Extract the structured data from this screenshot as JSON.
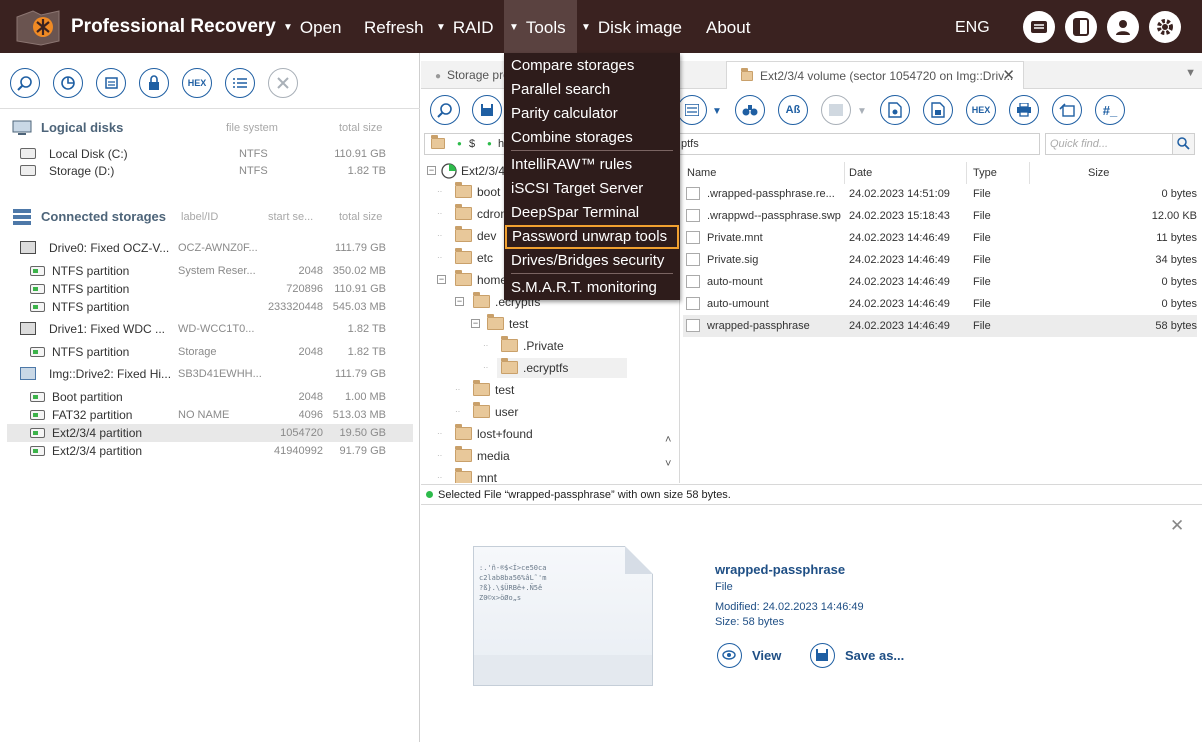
{
  "app": {
    "title": "Professional Recovery",
    "colors": {
      "topbar": "#3a2220",
      "accent": "#1f5fa3",
      "menu_active": "#5a4240",
      "highlight_border": "#f0a030",
      "status_ok": "#2dbb4b"
    }
  },
  "menu": {
    "items": [
      {
        "label": "Open",
        "has_arrow": true
      },
      {
        "label": "Refresh",
        "has_arrow": false
      },
      {
        "label": "RAID",
        "has_arrow": true
      },
      {
        "label": "Tools",
        "has_arrow": true,
        "active": true
      },
      {
        "label": "Disk image",
        "has_arrow": true
      },
      {
        "label": "About",
        "has_arrow": false
      }
    ],
    "language": "ENG",
    "right_icons": [
      "log-icon",
      "panel-toggle-icon",
      "user-icon",
      "settings-gear-icon"
    ]
  },
  "tools_menu": {
    "items": [
      {
        "label": "Compare storages"
      },
      {
        "label": "Parallel search"
      },
      {
        "label": "Parity calculator"
      },
      {
        "label": "Combine storages"
      },
      {
        "label": "IntelliRAW™ rules"
      },
      {
        "label": "iSCSI Target Server"
      },
      {
        "label": "DeepSpar Terminal"
      },
      {
        "label": "Password unwrap tools",
        "highlighted": true
      },
      {
        "label": "Drives/Bridges security"
      },
      {
        "label": "S.M.A.R.T. monitoring"
      }
    ]
  },
  "left": {
    "toolbar_icons": [
      "zoom-icon",
      "pie-chart-icon",
      "scan-icon",
      "lock-icon",
      "hex-icon",
      "list-icon",
      "close-icon"
    ],
    "hex_label": "HEX",
    "logical": {
      "title": "Logical disks",
      "col_fs": "file system",
      "col_size": "total size",
      "rows": [
        {
          "name": "Local Disk (C:)",
          "fs": "NTFS",
          "size": "110.91 GB"
        },
        {
          "name": "Storage (D:)",
          "fs": "NTFS",
          "size": "1.82 TB"
        }
      ]
    },
    "connected": {
      "title": "Connected storages",
      "col_label": "label/ID",
      "col_start": "start se...",
      "col_size": "total size",
      "rows": [
        {
          "kind": "drive",
          "name": "Drive0: Fixed OCZ-V...",
          "label": "OCZ-AWNZ0F...",
          "start": "",
          "size": "111.79 GB"
        },
        {
          "kind": "part",
          "name": "NTFS partition",
          "label": "System Reser...",
          "start": "2048",
          "size": "350.02 MB"
        },
        {
          "kind": "part",
          "name": "NTFS partition",
          "label": "",
          "start": "720896",
          "size": "110.91 GB"
        },
        {
          "kind": "part",
          "name": "NTFS partition",
          "label": "",
          "start": "233320448",
          "size": "545.03 MB"
        },
        {
          "kind": "drive",
          "name": "Drive1: Fixed WDC ...",
          "label": "WD-WCC1T0...",
          "start": "",
          "size": "1.82 TB"
        },
        {
          "kind": "part",
          "name": "NTFS partition",
          "label": "Storage",
          "start": "2048",
          "size": "1.82 TB"
        },
        {
          "kind": "image",
          "name": "Img::Drive2: Fixed Hi...",
          "label": "SB3D41EWHH...",
          "start": "",
          "size": "111.79 GB"
        },
        {
          "kind": "part",
          "name": "Boot partition",
          "label": "",
          "start": "2048",
          "size": "1.00 MB"
        },
        {
          "kind": "part",
          "name": "FAT32 partition",
          "label": "NO NAME",
          "start": "4096",
          "size": "513.03 MB"
        },
        {
          "kind": "part",
          "name": "Ext2/3/4 partition",
          "label": "",
          "start": "1054720",
          "size": "19.50 GB",
          "selected": true
        },
        {
          "kind": "part",
          "name": "Ext2/3/4 partition",
          "label": "",
          "start": "41940992",
          "size": "91.79 GB"
        }
      ]
    }
  },
  "tabs": [
    {
      "label": "Storage pro",
      "active": false
    },
    {
      "label": "Ext2/3/4 volume (sector 1054720 on Img::Driv...",
      "active": true
    }
  ],
  "path": {
    "seg1": "$",
    "seg2": "ho",
    "seg_last": "ptfs"
  },
  "find": {
    "placeholder": "Quick find..."
  },
  "tree": {
    "root": "Ext2/3/4",
    "nodes": [
      {
        "label": "boot",
        "level": 1
      },
      {
        "label": "cdrom",
        "level": 1
      },
      {
        "label": "dev",
        "level": 1
      },
      {
        "label": "etc",
        "level": 1
      },
      {
        "label": "home",
        "level": 1
      },
      {
        "label": ".ecryptfs",
        "level": 2
      },
      {
        "label": "test",
        "level": 3
      },
      {
        "label": ".Private",
        "level": 4
      },
      {
        "label": ".ecryptfs",
        "level": 4,
        "selected": true
      },
      {
        "label": "test",
        "level": 2
      },
      {
        "label": "user",
        "level": 2
      },
      {
        "label": "lost+found",
        "level": 1
      },
      {
        "label": "media",
        "level": 1
      },
      {
        "label": "mnt",
        "level": 1
      }
    ]
  },
  "files": {
    "columns": {
      "name": "Name",
      "date": "Date",
      "type": "Type",
      "size": "Size"
    },
    "rows": [
      {
        "name": ".wrapped-passphrase.re...",
        "date": "24.02.2023 14:51:09",
        "type": "File",
        "size": "0 bytes"
      },
      {
        "name": ".wrappwd--passphrase.swp",
        "date": "24.02.2023 15:18:43",
        "type": "File",
        "size": "12.00 KB"
      },
      {
        "name": "Private.mnt",
        "date": "24.02.2023 14:46:49",
        "type": "File",
        "size": "11 bytes"
      },
      {
        "name": "Private.sig",
        "date": "24.02.2023 14:46:49",
        "type": "File",
        "size": "34 bytes"
      },
      {
        "name": "auto-mount",
        "date": "24.02.2023 14:46:49",
        "type": "File",
        "size": "0 bytes"
      },
      {
        "name": "auto-umount",
        "date": "24.02.2023 14:46:49",
        "type": "File",
        "size": "0 bytes"
      },
      {
        "name": "wrapped-passphrase",
        "date": "24.02.2023 14:46:49",
        "type": "File",
        "size": "58 bytes",
        "selected": true
      }
    ]
  },
  "status": {
    "text": "Selected File “wrapped-passphrase” with own size 58 bytes."
  },
  "preview": {
    "thumb_text": ":.'ñ-®$<Í>ce50ca\nc2lab8ba56%âL˜'m\n?ß}.\\$ÜRBê+.Ñ5ê\nZ0©x>öØo„s",
    "name": "wrapped-passphrase",
    "type": "File",
    "modified": "Modified: 24.02.2023 14:46:49",
    "size": "Size: 58 bytes",
    "view_label": "View",
    "save_label": "Save as..."
  }
}
